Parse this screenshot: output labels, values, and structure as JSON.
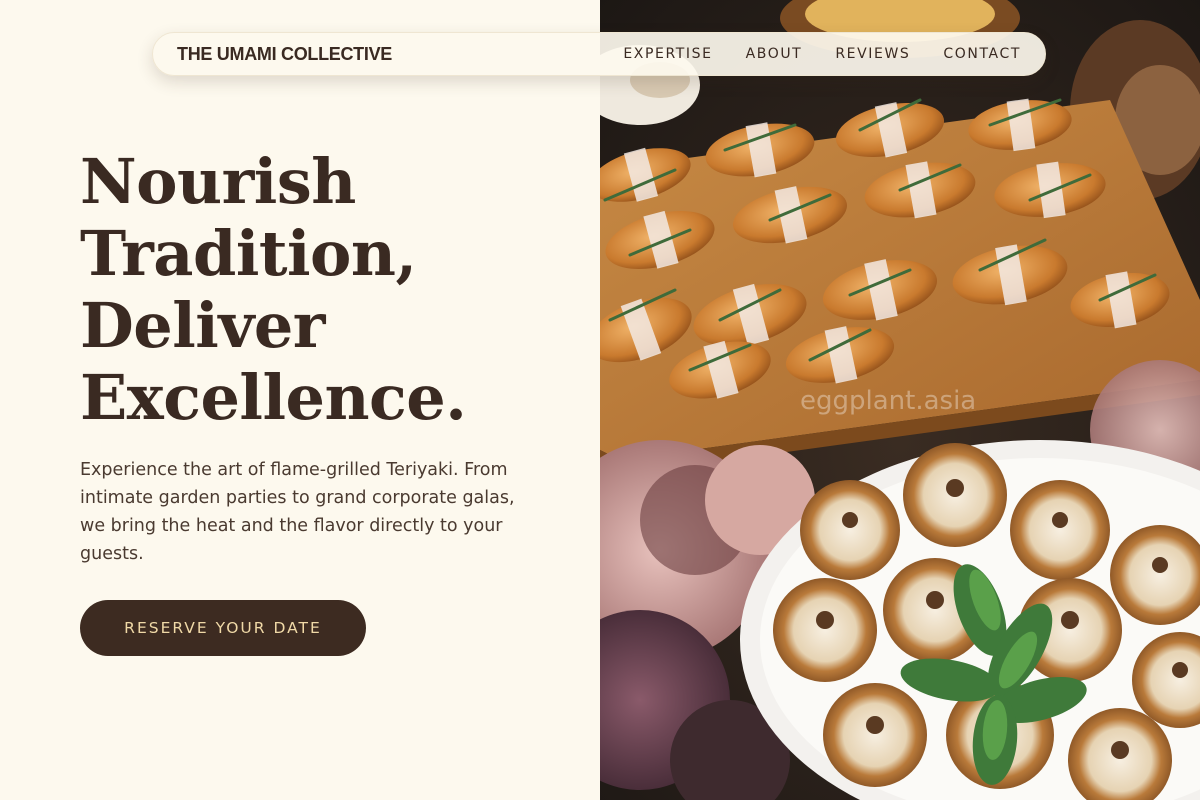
{
  "brand": {
    "name": "THE UMAMI COLLECTIVE"
  },
  "nav": {
    "links": [
      "EXPERTISE",
      "ABOUT",
      "REVIEWS",
      "CONTACT"
    ]
  },
  "hero": {
    "headline_lines": [
      "Nourish",
      "Tradition,",
      "Deliver",
      "Excellence."
    ],
    "description": "Experience the art of flame-grilled Teriyaki. From intimate garden parties to grand corporate galas, we bring the heat and the flavor directly to your guests.",
    "cta_label": "RESERVE YOUR DATE"
  },
  "image": {
    "watermark": "eggplant.asia",
    "subject": "catering spread with croissant sandwiches tied with twine and rosemary on a wooden board, and cream tarts on a white plate with mint garnish"
  },
  "colors": {
    "background": "#fdf9ee",
    "primary_dark": "#3d2b21",
    "button_text": "#f0d9a7",
    "text": "#3a2a22"
  }
}
